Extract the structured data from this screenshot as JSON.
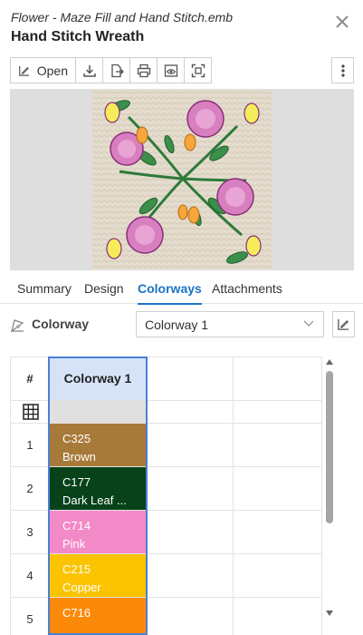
{
  "header": {
    "file_name": "Flower - Maze Fill and Hand Stitch.emb",
    "title": "Hand Stitch Wreath"
  },
  "toolbar": {
    "open_label": "Open",
    "icons": [
      "edit-icon",
      "download-icon",
      "export-icon",
      "print-icon",
      "preview-icon",
      "fit-icon"
    ],
    "more_icon": "more-vertical-icon"
  },
  "tabs": [
    {
      "label": "Summary",
      "active": false
    },
    {
      "label": "Design",
      "active": false
    },
    {
      "label": "Colorways",
      "active": true
    },
    {
      "label": "Attachments",
      "active": false
    }
  ],
  "colorway": {
    "label": "Colorway",
    "selected": "Colorway 1"
  },
  "grid": {
    "hash_header": "#",
    "column_header": "Colorway 1",
    "rows": [
      {
        "num": "1",
        "code": "C325",
        "name": "Brown",
        "color": "#a87a3a"
      },
      {
        "num": "2",
        "code": "C177",
        "name": "Dark Leaf ...",
        "color": "#07421a"
      },
      {
        "num": "3",
        "code": "C714",
        "name": "Pink",
        "color": "#f38ac8"
      },
      {
        "num": "4",
        "code": "C215",
        "name": "Copper",
        "color": "#fcc400"
      },
      {
        "num": "5",
        "code": "C716",
        "name": "",
        "color": "#fc8a0a"
      }
    ]
  },
  "colors": {
    "accent": "#1a73c8",
    "column_highlight": "#d6e3f7",
    "column_border": "#4a7fd4"
  }
}
